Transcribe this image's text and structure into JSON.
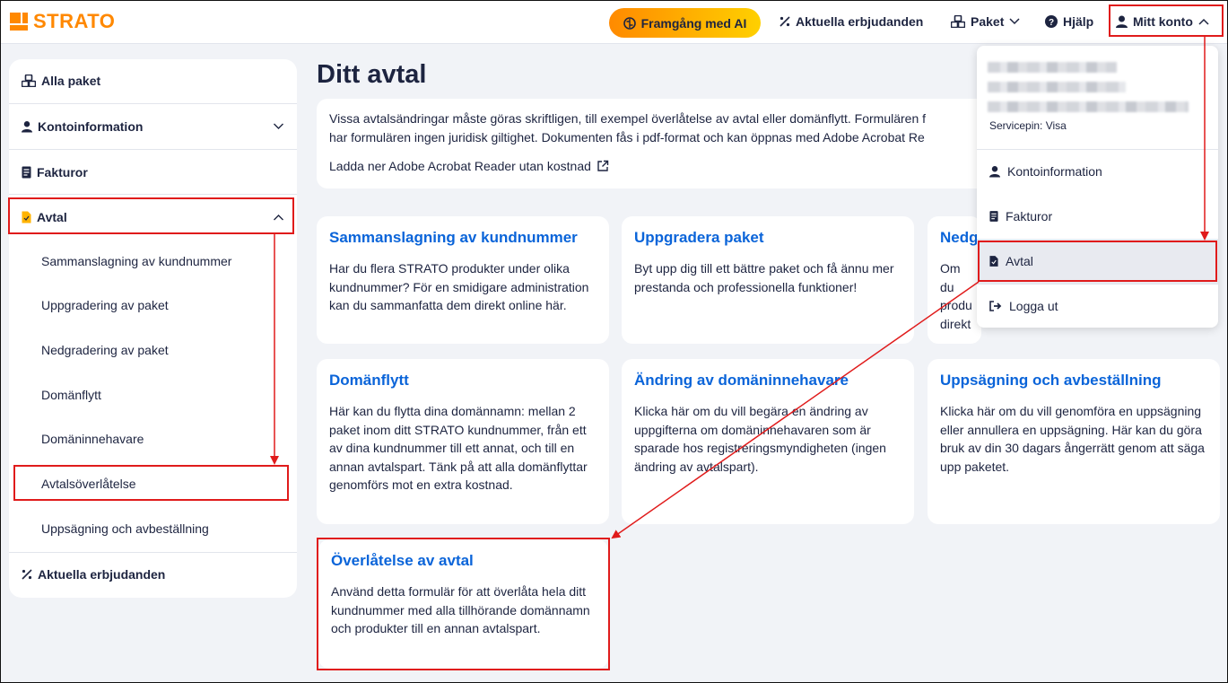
{
  "brand": {
    "name": "STRATO",
    "color": "#ff8800"
  },
  "header": {
    "ai_button": "Framgång med AI",
    "offers": "Aktuella erbjudanden",
    "packages": "Paket",
    "help": "Hjälp",
    "account": "Mitt konto"
  },
  "sidebar": {
    "all_packages": "Alla paket",
    "account_info": "Kontoinformation",
    "invoices": "Fakturor",
    "contract": "Avtal",
    "sub_items": [
      "Sammanslagning av kundnummer",
      "Uppgradering av paket",
      "Nedgradering av paket",
      "Domänflytt",
      "Domäninnehavare",
      "Avtalsöverlåtelse",
      "Uppsägning och avbeställning"
    ],
    "current_offers": "Aktuella erbjudanden"
  },
  "main": {
    "title": "Ditt avtal",
    "info_line1": "Vissa avtalsändringar måste göras skriftligen, till exempel överlåtelse av avtal eller domänflytt. Formulären f",
    "info_line2": "har formulären ingen juridisk giltighet. Dokumenten fås i pdf-format och kan öppnas med Adobe Acrobat Re",
    "acrobat_link": "Ladda ner Adobe Acrobat Reader utan kostnad",
    "cards": [
      {
        "title": "Sammanslagning av kundnummer",
        "body": "Har du flera STRATO produkter under olika kundnummer? För en smidigare administration kan du sammanfatta dem direkt online här."
      },
      {
        "title": "Uppgradera paket",
        "body": "Byt upp dig till ett bättre paket och få ännu mer prestanda och professionella funktioner!"
      },
      {
        "title": "Nedg",
        "body_lines": [
          "Om du",
          "produ",
          "direkt"
        ]
      },
      {
        "title": "Domänflytt",
        "body": "Här kan du flytta dina domännamn: mellan 2 paket inom ditt STRATO kundnummer, från ett av dina kundnummer till ett annat, och till en annan avtalspart. Tänk på att alla domänflyttar genomförs mot en extra kostnad."
      },
      {
        "title": "Ändring av domäninnehavare",
        "body": "Klicka här om du vill begära en ändring av uppgifterna om domäninnehavaren som är sparade hos registreringsmyndigheten (ingen ändring av avtalspart)."
      },
      {
        "title": "Uppsägning och avbeställning",
        "body": "Klicka här om du vill genomföra en uppsägning eller annullera en uppsägning. Här kan du göra bruk av din 30 dagars ångerrätt genom att säga upp paketet."
      },
      {
        "title": "Överlåtelse av avtal",
        "body": "Använd detta formulär för att överlåta hela ditt kundnummer med alla tillhörande domännamn och produkter till en annan avtalspart."
      }
    ]
  },
  "dropdown": {
    "servicepin_label": "Servicepin:",
    "servicepin_action": "Visa",
    "items": [
      "Kontoinformation",
      "Fakturor",
      "Avtal",
      "Logga ut"
    ]
  },
  "colors": {
    "link": "#0a64d9",
    "annotation": "#e01b1b",
    "text": "#1d2440"
  }
}
